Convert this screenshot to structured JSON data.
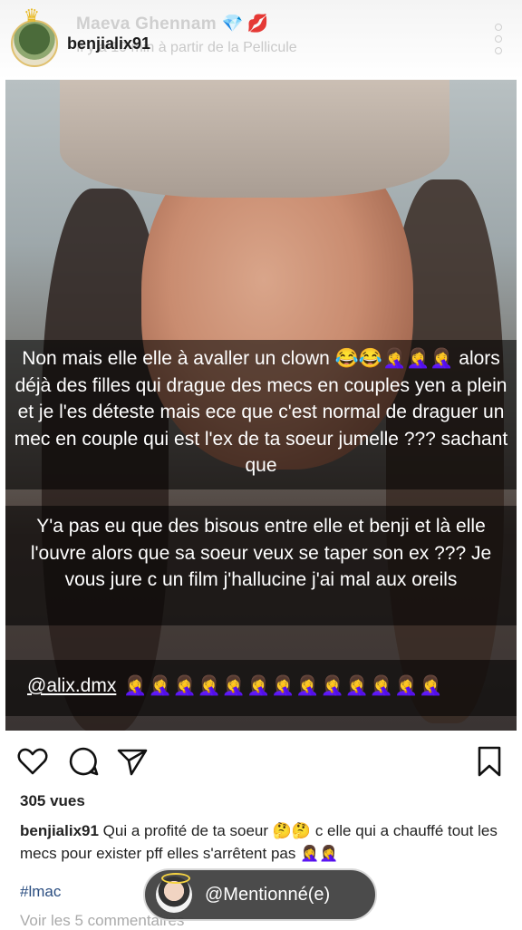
{
  "header": {
    "story_name": "Maeva Ghennam",
    "story_name_emojis": [
      "💎",
      "💋"
    ],
    "username": "benjialix91",
    "story_meta": "Il y a 10 min à partir de la Pellicule"
  },
  "overlays": {
    "first": {
      "text": "Non mais elle elle à avaller un clown 😂😂🤦‍♀️🤦‍♀️🤦‍♀️ alors déjà des filles qui drague des mecs en couples yen a plein et je l'es déteste mais ece que c'est normal de draguer un mec en couple qui est l'ex de ta soeur jumelle ??? sachant que"
    },
    "second": {
      "text": "Y'a pas eu que des bisous entre elle et benji et là elle l'ouvre alors que sa soeur veux se taper son ex ??? Je vous jure c un film j'hallucine j'ai mal aux oreils"
    },
    "mention": {
      "handle": "@alix.dmx",
      "emojis": "🤦‍♀️🤦‍♀️🤦‍♀️🤦‍♀️🤦‍♀️🤦‍♀️🤦‍♀️🤦‍♀️🤦‍♀️🤦‍♀️🤦‍♀️🤦‍♀️🤦‍♀️"
    }
  },
  "actions": {
    "icons": [
      "heart-icon",
      "comment-icon",
      "share-icon",
      "bookmark-icon"
    ]
  },
  "post": {
    "views": "305 vues",
    "caption_user": "benjialix91",
    "caption_text": " Qui a profité de ta soeur 🤔🤔 c elle qui a chauffé tout les mecs pour exister pff elles s'arrêtent pas 🤦‍♀️🤦‍♀️",
    "hashtag": "#lmac",
    "comments_link": "Voir les 5 commentaires"
  },
  "mention_pill": {
    "label": "@Mentionné(e)"
  },
  "colors": {
    "hashtag": "#2a4d80",
    "overlay": "rgba(0,0,0,0.56)"
  }
}
